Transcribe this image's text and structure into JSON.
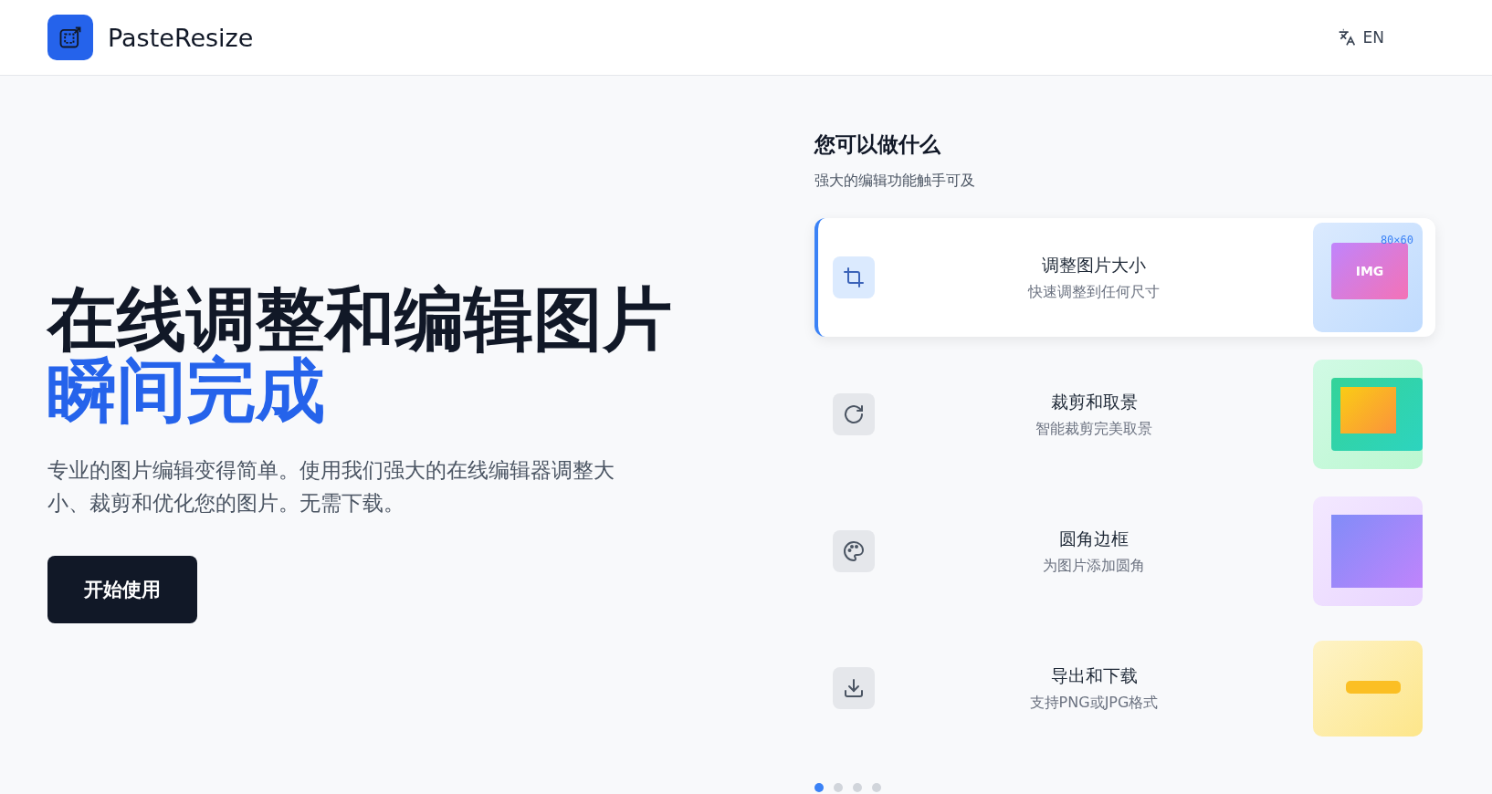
{
  "header": {
    "brand": "PasteResize",
    "language": "EN"
  },
  "hero": {
    "title": "在线调整和编辑图片",
    "highlight": "瞬间完成",
    "description": "专业的图片编辑变得简单。使用我们强大的在线编辑器调整大小、裁剪和优化您的图片。无需下载。",
    "cta": "开始使用"
  },
  "features": {
    "heading": "您可以做什么",
    "subheading": "强大的编辑功能触手可及",
    "items": [
      {
        "kind": "resize",
        "title": "调整图片大小",
        "subtitle": "快速调整到任何尺寸",
        "selected": true,
        "preview_label": "IMG",
        "preview_size": "80×60"
      },
      {
        "kind": "crop",
        "title": "裁剪和取景",
        "subtitle": "智能裁剪完美取景",
        "selected": false
      },
      {
        "kind": "rounded",
        "title": "圆角边框",
        "subtitle": "为图片添加圆角",
        "selected": false
      },
      {
        "kind": "export",
        "title": "导出和下载",
        "subtitle": "支持PNG或JPG格式",
        "selected": false
      }
    ],
    "dots": [
      {
        "selected": true
      },
      {
        "selected": false
      },
      {
        "selected": false
      },
      {
        "selected": false
      }
    ]
  }
}
